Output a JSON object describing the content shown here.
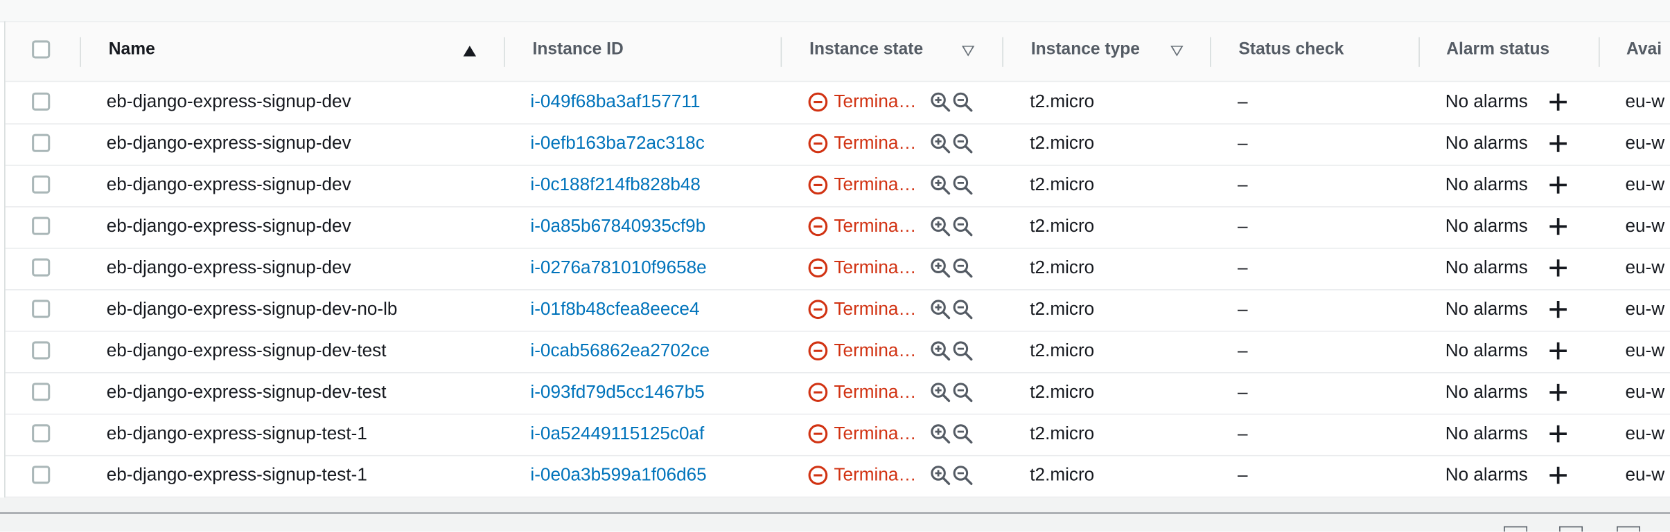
{
  "table": {
    "columns": {
      "name": "Name",
      "instance_id": "Instance ID",
      "instance_state": "Instance state",
      "instance_type": "Instance type",
      "status_check": "Status check",
      "alarm_status": "Alarm status",
      "availability_zone": "Avai"
    },
    "sort": {
      "column": "Name",
      "direction": "ascending"
    },
    "rows": [
      {
        "name": "eb-django-express-signup-dev",
        "instance_id": "i-049f68ba3af157711",
        "state": "Termina…",
        "type": "t2.micro",
        "status_check": "–",
        "alarm_status": "No alarms",
        "az": "eu-w"
      },
      {
        "name": "eb-django-express-signup-dev",
        "instance_id": "i-0efb163ba72ac318c",
        "state": "Termina…",
        "type": "t2.micro",
        "status_check": "–",
        "alarm_status": "No alarms",
        "az": "eu-w"
      },
      {
        "name": "eb-django-express-signup-dev",
        "instance_id": "i-0c188f214fb828b48",
        "state": "Termina…",
        "type": "t2.micro",
        "status_check": "–",
        "alarm_status": "No alarms",
        "az": "eu-w"
      },
      {
        "name": "eb-django-express-signup-dev",
        "instance_id": "i-0a85b67840935cf9b",
        "state": "Termina…",
        "type": "t2.micro",
        "status_check": "–",
        "alarm_status": "No alarms",
        "az": "eu-w"
      },
      {
        "name": "eb-django-express-signup-dev",
        "instance_id": "i-0276a781010f9658e",
        "state": "Termina…",
        "type": "t2.micro",
        "status_check": "–",
        "alarm_status": "No alarms",
        "az": "eu-w"
      },
      {
        "name": "eb-django-express-signup-dev-no-lb",
        "instance_id": "i-01f8b48cfea8eece4",
        "state": "Termina…",
        "type": "t2.micro",
        "status_check": "–",
        "alarm_status": "No alarms",
        "az": "eu-w"
      },
      {
        "name": "eb-django-express-signup-dev-test",
        "instance_id": "i-0cab56862ea2702ce",
        "state": "Termina…",
        "type": "t2.micro",
        "status_check": "–",
        "alarm_status": "No alarms",
        "az": "eu-w"
      },
      {
        "name": "eb-django-express-signup-dev-test",
        "instance_id": "i-093fd79d5cc1467b5",
        "state": "Termina…",
        "type": "t2.micro",
        "status_check": "–",
        "alarm_status": "No alarms",
        "az": "eu-w"
      },
      {
        "name": "eb-django-express-signup-test-1",
        "instance_id": "i-0a52449115125c0af",
        "state": "Termina…",
        "type": "t2.micro",
        "status_check": "–",
        "alarm_status": "No alarms",
        "az": "eu-w"
      },
      {
        "name": "eb-django-express-signup-test-1",
        "instance_id": "i-0e0a3b599a1f06d65",
        "state": "Termina…",
        "type": "t2.micro",
        "status_check": "–",
        "alarm_status": "No alarms",
        "az": "eu-w"
      }
    ],
    "icons": {
      "state": "terminated-icon",
      "zoom_in": "zoom-in-icon",
      "zoom_out": "zoom-out-icon",
      "add_alarm": "plus-icon"
    },
    "colors": {
      "link": "#0073bb",
      "terminated": "#d13212",
      "header_text": "#16191f",
      "divider": "#e9ebed"
    }
  }
}
